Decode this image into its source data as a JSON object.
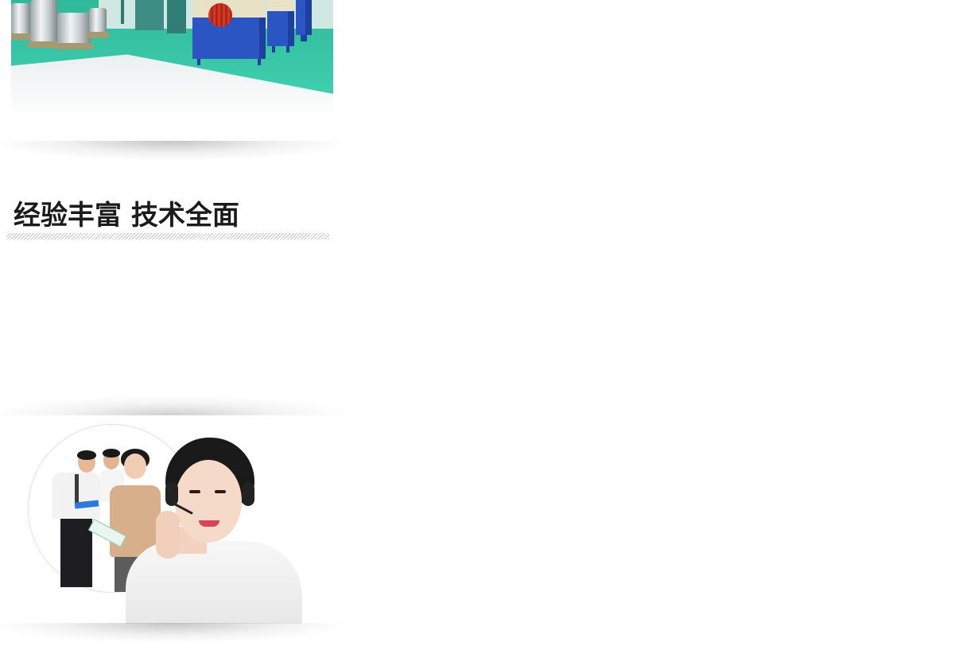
{
  "heading": {
    "text": "经验丰富 技术全面"
  },
  "images": {
    "factory": "factory-equipment-photo",
    "service": "customer-service-team-photo"
  }
}
